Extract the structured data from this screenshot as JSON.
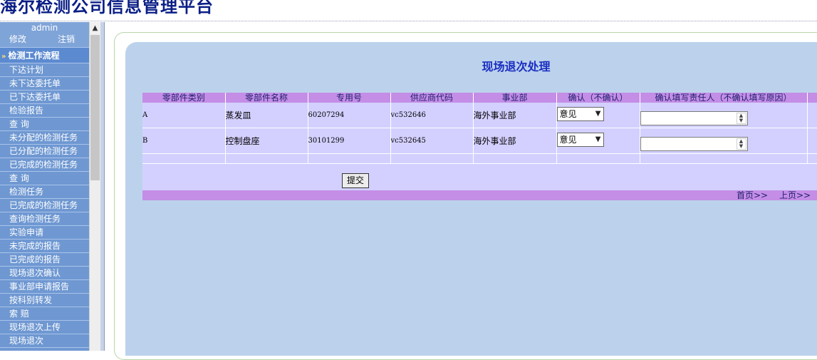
{
  "app": {
    "title": "海尔检测公司信息管理平台"
  },
  "sidebar": {
    "user": "admin",
    "modify": "修改",
    "logout": "注销",
    "section": "检测工作流程",
    "items": [
      "下达计划",
      "未下达委托单",
      "已下达委托单",
      "检验报告",
      "查  询",
      "未分配的检测任务",
      "已分配的检测任务",
      "已完成的检测任务",
      "查  询",
      "检测任务",
      "已完成的检测任务",
      "查询检测任务",
      "实验申请",
      "未完成的报告",
      "已完成的报告",
      "现场退次确认",
      "事业部申请报告",
      "按科别转发",
      "索  赔",
      "现场退次上传",
      "现场退次"
    ]
  },
  "page": {
    "title": "现场退次处理",
    "columns": [
      "零部件类别",
      "零部件名称",
      "专用号",
      "供应商代码",
      "事业部",
      "确认（不确认）",
      "确认填写责任人（不确认填写原因）"
    ],
    "rows": [
      {
        "category": "A",
        "name": "蒸发皿",
        "code": "60207294",
        "supplier": "vc532646",
        "division": "海外事业部",
        "confirm": "意见",
        "responsible": ""
      },
      {
        "category": "B",
        "name": "控制盘座",
        "code": "30101299",
        "supplier": "vc532645",
        "division": "海外事业部",
        "confirm": "意见",
        "responsible": ""
      }
    ],
    "submit_label": "提交",
    "pager": {
      "first": "首页>>",
      "prev": "上页>>"
    }
  },
  "colors": {
    "sidebar": "#6f98d2",
    "header_bar": "#c48ee6",
    "row_bg": "#d3d0ff",
    "panel": "#bcd2ec",
    "title": "#1b2ec2"
  },
  "icons": {
    "section_arrow": "double-chevron-right-icon",
    "select": "chevron-down-icon",
    "spinner": "spinner-arrows-icon",
    "scroll_up": "scroll-up-icon"
  }
}
